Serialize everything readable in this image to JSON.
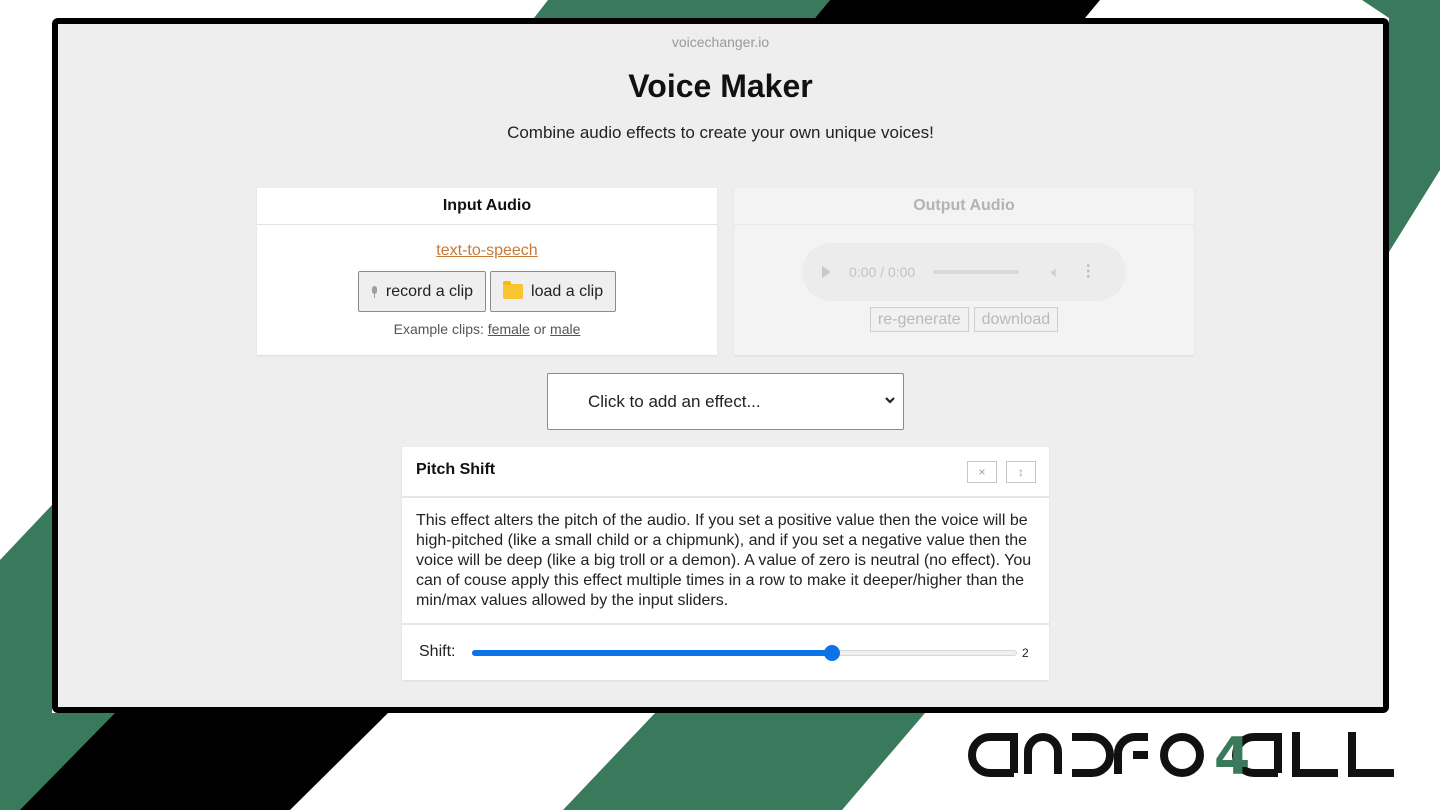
{
  "site": {
    "domain": "voicechanger.io",
    "title": "Voice Maker",
    "subtitle": "Combine audio effects to create your own unique voices!"
  },
  "input_audio": {
    "heading": "Input Audio",
    "tts_link": "text-to-speech",
    "record_button": {
      "label": "record a clip",
      "icon": "microphone-icon"
    },
    "load_button": {
      "label": "load a clip",
      "icon": "folder-icon"
    },
    "examples_prefix": "Example clips:",
    "example_female": "female",
    "examples_or": "or",
    "example_male": "male"
  },
  "output_audio": {
    "heading": "Output Audio",
    "player": {
      "time": "0:00 / 0:00",
      "progress": 0
    },
    "regenerate_label": "re-generate",
    "download_label": "download"
  },
  "effect_select": {
    "selected": "Click to add an effect..."
  },
  "effect_card": {
    "title": "Pitch Shift",
    "close_symbol": "×",
    "move_symbol": "↕",
    "description": "This effect alters the pitch of the audio. If you set a positive value then the voice will be high-pitched (like a small child or a chipmunk), and if you set a negative value then the voice will be deep (like a big troll or a demon). A value of zero is neutral (no effect). You can of couse apply this effect multiple times in a row to make it deeper/higher than the min/max values allowed by the input sliders.",
    "slider": {
      "label": "Shift:",
      "value": "2",
      "fill_fraction": 0.66
    }
  },
  "watermark": {
    "text_left": "andro",
    "text_number": "4",
    "text_right": "all"
  },
  "colors": {
    "accent_blue": "#0b72e7",
    "link_orange": "#c77a35",
    "brand_green": "#387a5b",
    "frame_black": "#000000"
  }
}
